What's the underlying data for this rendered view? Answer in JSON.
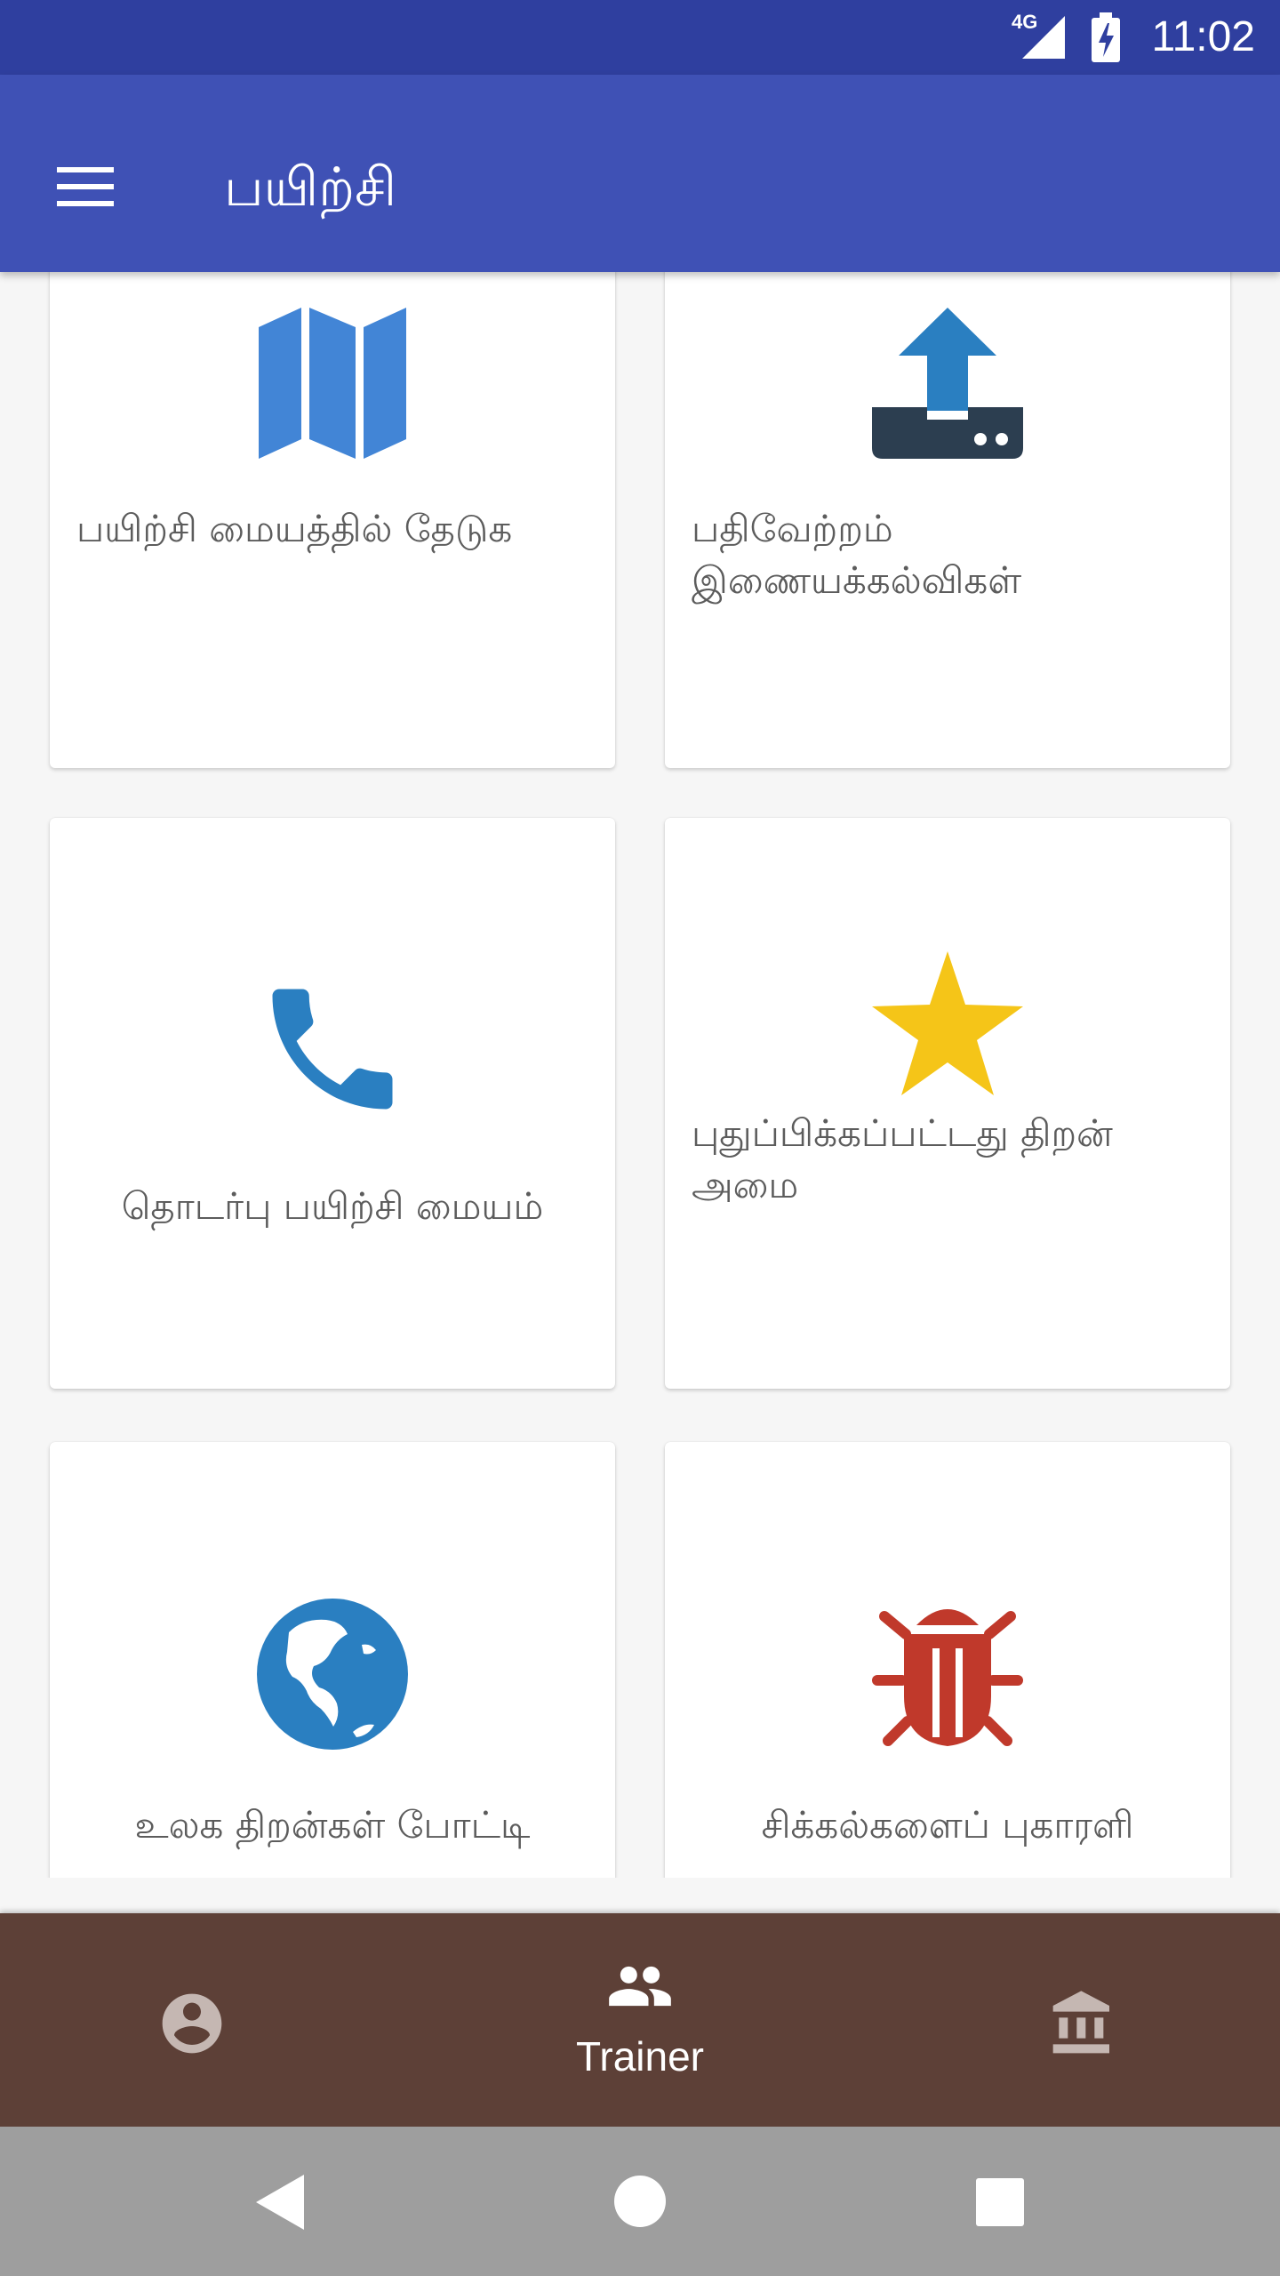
{
  "status_bar": {
    "network": "4G",
    "time": "11:02"
  },
  "app_bar": {
    "title": "பயிற்சி",
    "menu_icon": "hamburger-menu-icon"
  },
  "cards": [
    {
      "label": "பயிற்சி மையத்தில் தேடுக",
      "icon": "map-icon",
      "color": "#4285d6"
    },
    {
      "label": "பதிவேற்றம் இணையக்கல்விகள்",
      "icon": "upload-icon",
      "color": "#2a7fc1"
    },
    {
      "label": "தொடர்பு பயிற்சி மையம்",
      "icon": "phone-icon",
      "color": "#2a7fc1"
    },
    {
      "label": "புதுப்பிக்கப்பட்டது திறன் அமை",
      "icon": "star-icon",
      "color": "#f5c518"
    },
    {
      "label": "உலக திறன்கள் போட்டி",
      "icon": "globe-icon",
      "color": "#2a7fc1"
    },
    {
      "label": "சிக்கல்களைப் புகாரளி",
      "icon": "bug-icon",
      "color": "#c0392b"
    }
  ],
  "bottom_nav": {
    "items": [
      {
        "icon": "account-circle-icon",
        "label": ""
      },
      {
        "icon": "people-icon",
        "label": "Trainer",
        "active": true
      },
      {
        "icon": "institution-icon",
        "label": ""
      }
    ],
    "background": "#5d4037"
  },
  "system_nav": {
    "items": [
      "back-icon",
      "home-icon",
      "recents-icon"
    ]
  }
}
